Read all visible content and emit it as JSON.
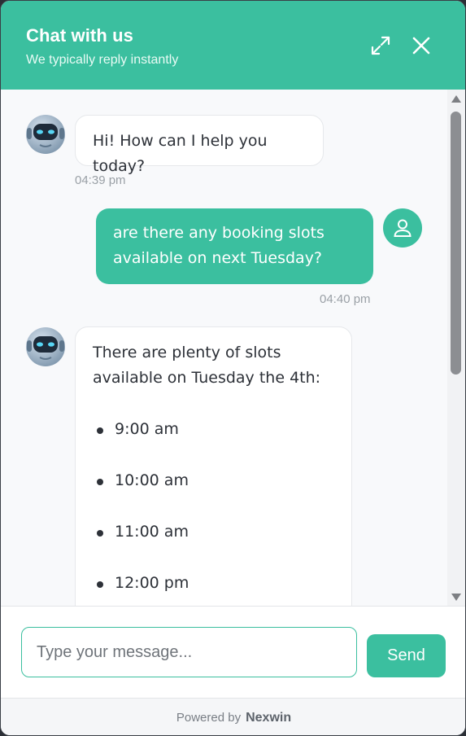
{
  "header": {
    "title": "Chat with us",
    "subtitle": "We typically reply instantly"
  },
  "messages": [
    {
      "sender": "bot",
      "text": "Hi! How can I help you today?",
      "time": "04:39 pm"
    },
    {
      "sender": "user",
      "text": "are there any booking slots available on next Tuesday?",
      "time": "04:40 pm"
    },
    {
      "sender": "bot",
      "text": "There are plenty of slots available on Tuesday the 4th:",
      "slots": [
        "9:00 am",
        "10:00 am",
        "11:00 am",
        "12:00 pm"
      ]
    }
  ],
  "composer": {
    "placeholder": "Type your message...",
    "send_label": "Send"
  },
  "footer": {
    "powered_by": "Powered by",
    "brand": "Nexwin"
  },
  "colors": {
    "accent": "#3bbf9f",
    "bot_bubble": "#ffffff",
    "text": "#2d3138"
  },
  "icons": {
    "expand": "expand-icon",
    "close": "close-icon",
    "bot_avatar": "robot-icon",
    "user_avatar": "user-icon"
  }
}
